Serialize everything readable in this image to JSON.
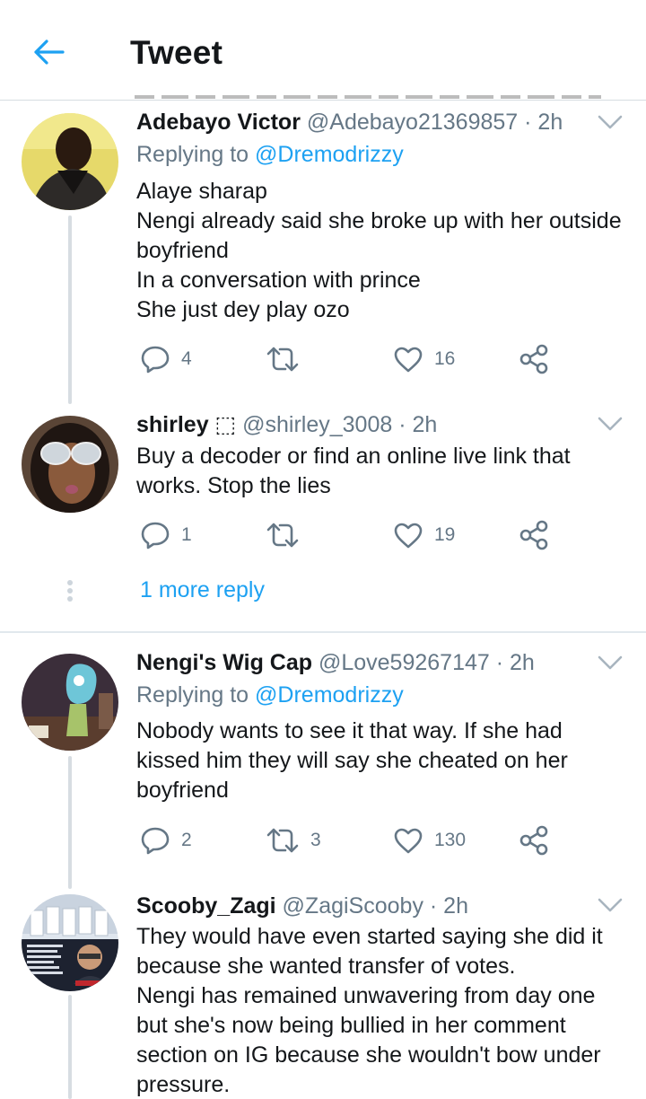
{
  "header": {
    "title": "Tweet",
    "back_icon": "arrow-left-icon",
    "accent": "#1da1f2"
  },
  "tweets": [
    {
      "name": "Adebayo Victor",
      "handle": "@Adebayo21369857 · 2h",
      "replying_prefix": "Replying to ",
      "replying_to": "@Dremodrizzy",
      "lines": [
        "Alaye sharap",
        "Nengi already said she broke up with her outside",
        "boyfriend",
        "In a conversation with prince",
        "She just dey play ozo"
      ],
      "replies": "4",
      "retweets": "",
      "likes": "16"
    },
    {
      "name": "shirley ⬚",
      "handle": "@shirley_3008 · 2h",
      "lines": [
        "Buy a decoder or find an online live link that",
        "works. Stop the lies"
      ],
      "replies": "1",
      "retweets": "",
      "likes": "19"
    },
    {
      "name": "Nengi's Wig Cap",
      "handle": "@Love59267147 · 2h",
      "replying_prefix": "Replying to ",
      "replying_to": "@Dremodrizzy",
      "lines": [
        "Nobody wants to see it that way. If she had",
        "kissed him they will say she cheated on her",
        "boyfriend"
      ],
      "replies": "2",
      "retweets": "3",
      "likes": "130"
    },
    {
      "name": "Scooby_Zagi",
      "handle": "@ZagiScooby · 2h",
      "lines": [
        "They would have even started saying she did it",
        "because she wanted transfer of votes.",
        "Nengi has remained unwavering from day one",
        "but she's now being bullied in her comment",
        "section on IG because she wouldn't bow under",
        "pressure."
      ]
    }
  ],
  "more_reply_label": "1 more reply",
  "icons": {
    "reply": "reply-icon",
    "retweet": "retweet-icon",
    "like": "heart-icon",
    "share": "share-icon",
    "menu": "chevron-down-icon"
  },
  "colors": {
    "text": "#14171a",
    "secondary": "#657786",
    "link": "#1da1f2",
    "divider": "#e1e8ed"
  }
}
